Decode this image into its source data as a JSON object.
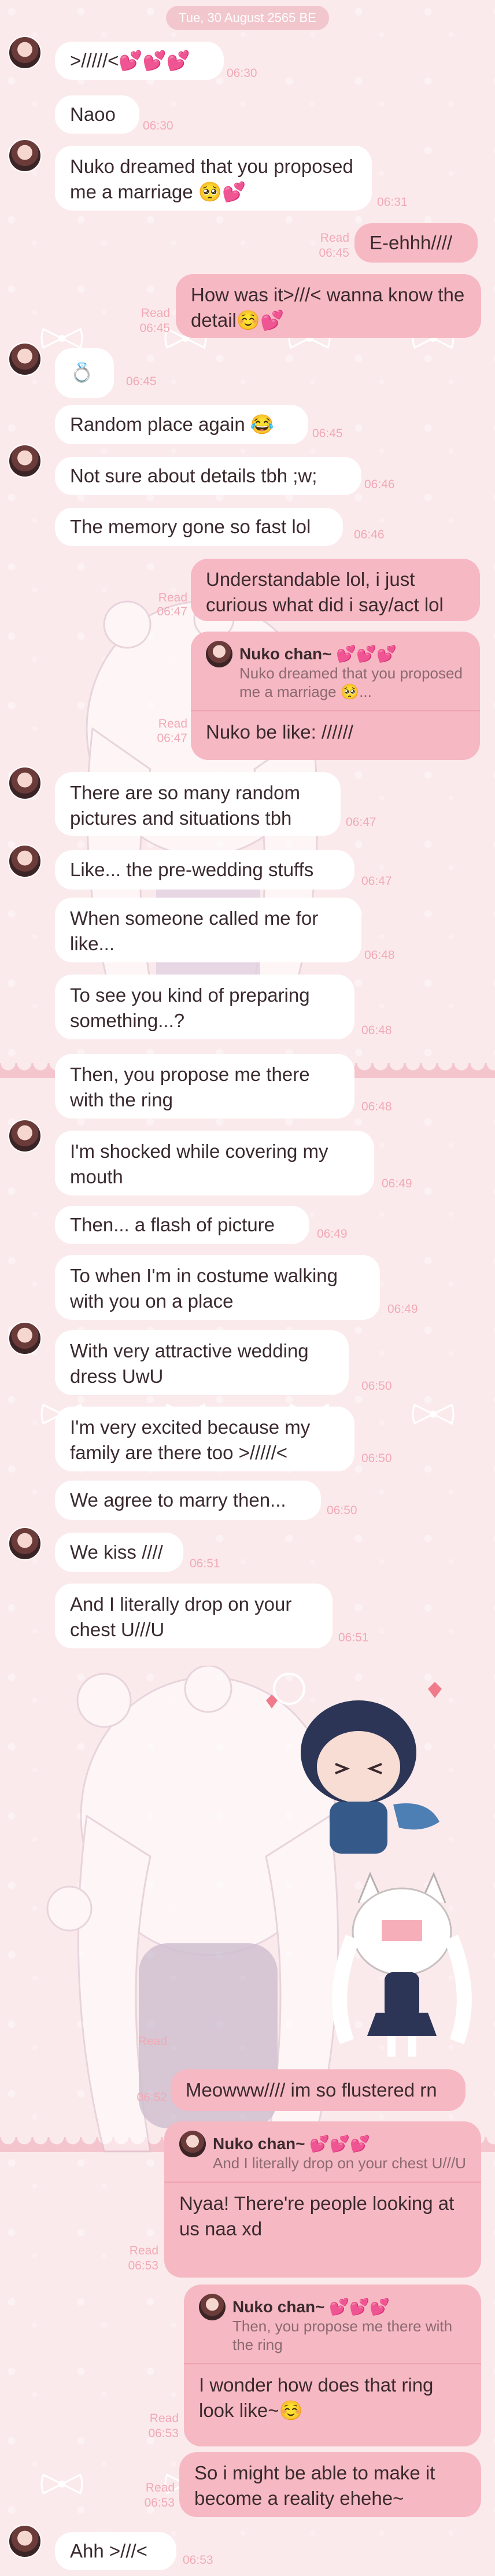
{
  "date_label": "Tue, 30 August 2565 BE",
  "messages": [
    {
      "text": ">/////<💕💕💕",
      "time": "06:30"
    },
    {
      "text": "Naoo",
      "time": "06:30"
    },
    {
      "text": "Nuko dreamed that you proposed me a marriage 🥺💕",
      "time": "06:31"
    },
    {
      "text": "E-ehhh////",
      "read": "Read",
      "time": "06:45"
    },
    {
      "text": "How was it>///< wanna know the detail☺️💕",
      "read": "Read",
      "time": "06:45"
    },
    {
      "text": "💍",
      "time": "06:45"
    },
    {
      "text": "Random place again 😂",
      "time": "06:45"
    },
    {
      "text": "Not sure about details tbh ;w;",
      "time": "06:46"
    },
    {
      "text": "The memory gone so fast lol",
      "time": "06:46"
    },
    {
      "text": "Understandable lol, i just curious what did i say/act lol",
      "read": "Read",
      "time": "06:47"
    },
    {
      "reply_name": "Nuko chan~ 💕💕💕",
      "reply_text": "Nuko dreamed that you proposed me a marriage 🥺...",
      "text": "Nuko be like: //////",
      "read": "Read",
      "time": "06:47"
    },
    {
      "text": "There are so many random pictures and situations tbh",
      "time": "06:47"
    },
    {
      "text": "Like... the pre-wedding stuffs",
      "time": "06:47"
    },
    {
      "text": "When someone called me for like...",
      "time": "06:48"
    },
    {
      "text": "To see you kind of preparing something...?",
      "time": "06:48"
    },
    {
      "text": "Then, you propose me there with the ring",
      "time": "06:48"
    },
    {
      "text": "I'm shocked while covering my mouth",
      "time": "06:49"
    },
    {
      "text": "Then... a flash of picture",
      "time": "06:49"
    },
    {
      "text": "To when I'm in costume walking with you on a place",
      "time": "06:49"
    },
    {
      "text": "With very attractive wedding dress UwU",
      "time": "06:50"
    },
    {
      "text": "I'm very excited because my family are there too >/////<",
      "time": "06:50"
    },
    {
      "text": "We agree to marry then...",
      "time": "06:50"
    },
    {
      "text": "We kiss ////",
      "time": "06:51"
    },
    {
      "text": "And I literally drop on your chest U///U",
      "time": "06:51"
    },
    {
      "text": "Meowww//// im so flustered rn",
      "read": "Read",
      "time": "06:52"
    },
    {
      "reply_name": "Nuko chan~ 💕💕💕",
      "reply_text": "And I literally drop on your chest U///U",
      "text": "Nyaa! There're people looking at us naa xd",
      "read": "Read",
      "time": "06:53"
    },
    {
      "reply_name": "Nuko chan~ 💕💕💕",
      "reply_text": "Then, you propose me there with the ring",
      "text": "I wonder how does that ring look like~☺️",
      "read": "Read",
      "time": "06:53"
    },
    {
      "text": "So i might be able to make it become a reality ehehe~",
      "read": "Read",
      "time": "06:53"
    },
    {
      "text": "Ahh >///<",
      "time": "06:53"
    }
  ],
  "colors": {
    "background": "#fbeaec",
    "incoming_bubble": "#ffffff",
    "outgoing_bubble": "#f6b8c3",
    "timestamp": "#f1a9b5"
  }
}
